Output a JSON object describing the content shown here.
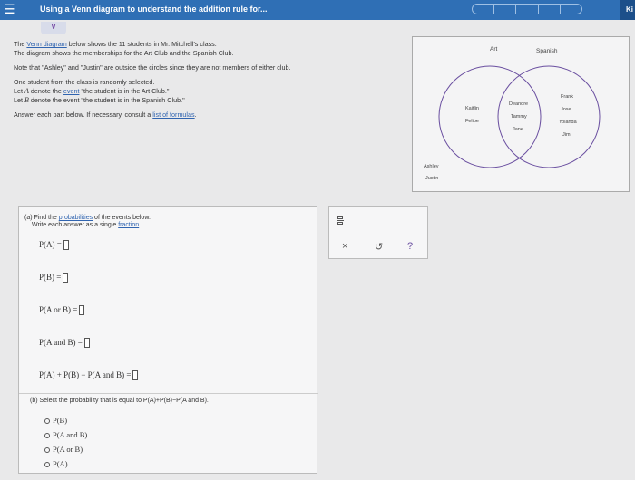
{
  "header": {
    "title": "Using a Venn diagram to understand the addition rule for...",
    "corner": "Ki"
  },
  "intro": {
    "line1_pre": "The ",
    "line1_link": "Venn diagram",
    "line1_post": " below shows the 11 students in Mr. Mitchell's class.",
    "line2": "The diagram shows the memberships for the Art Club and the Spanish Club.",
    "line3": "Note that \"Ashley\" and \"Justin\" are outside the circles since they are not members of either club.",
    "line4": "One student from the class is randomly selected.",
    "line5_pre": "Let ",
    "line5_var": "A",
    "line5_mid": " denote the ",
    "line5_link": "event",
    "line5_post": " \"the student is in the Art Club.\"",
    "line6_pre": "Let ",
    "line6_var": "B",
    "line6_post": " denote the event \"the student is in the Spanish Club.\"",
    "line7_pre": "Answer each part below. If necessary, consult a ",
    "line7_link": "list of formulas",
    "line7_post": "."
  },
  "venn": {
    "art_label": "Art",
    "spanish_label": "Spanish",
    "art_only": [
      "Kaitlin",
      "Felipe"
    ],
    "both": [
      "Deandre",
      "Tammy",
      "Jane"
    ],
    "spanish_only": [
      "Frank",
      "Jose",
      "Yolanda",
      "Jim"
    ],
    "outside": [
      "Ashley",
      "Justin"
    ]
  },
  "part_a": {
    "title_pre": "(a) Find the ",
    "title_link": "probabilities",
    "title_post": " of the events below.",
    "subtitle_pre": "Write each answer as a single ",
    "subtitle_link": "fraction",
    "subtitle_post": ".",
    "exprs": [
      "P(A) =",
      "P(B) =",
      "P(A or B) =",
      "P(A and B) =",
      "P(A) + P(B) − P(A and B) ="
    ]
  },
  "part_b": {
    "prompt": "(b) Select the probability that is equal to P(A)+P(B)−P(A and B).",
    "options": [
      "P(B)",
      "P(A and B)",
      "P(A or B)",
      "P(A)"
    ]
  },
  "tools": {
    "clear": "×",
    "undo": "↺",
    "help": "?"
  },
  "colors": {
    "header": "#2f6fb5",
    "circle": "#6a4fa0",
    "link": "#3064b0"
  }
}
